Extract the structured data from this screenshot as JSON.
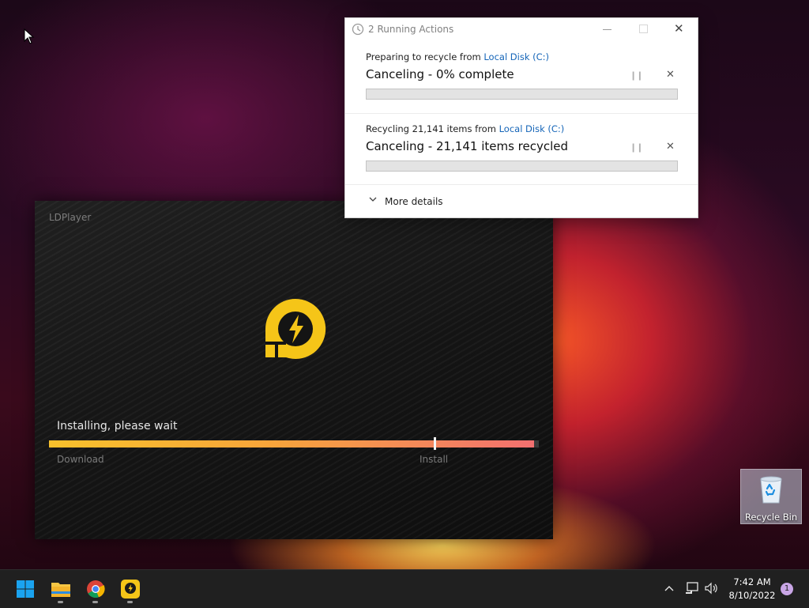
{
  "ldplayer": {
    "title": "LDPlayer",
    "status": "Installing, please wait",
    "progress_fraction": 0.99,
    "steps": [
      "Download",
      "Install"
    ],
    "accent": "#f8c12c"
  },
  "dialog": {
    "title": "2 Running Actions",
    "operations": [
      {
        "prefix": "Preparing to recycle from ",
        "source": "Local Disk (C:)",
        "status": "Canceling - 0% complete",
        "progress_fraction": 0
      },
      {
        "prefix": "Recycling 21,141 items from ",
        "source": "Local Disk (C:)",
        "status": "Canceling - 21,141 items recycled",
        "progress_fraction": 0
      }
    ],
    "more_details": "More details",
    "link_color": "#1565b8"
  },
  "desktop": {
    "recycle_bin_label": "Recycle Bin"
  },
  "taskbar": {
    "apps": [
      {
        "name": "start-button",
        "icon": "windows-logo"
      },
      {
        "name": "file-explorer",
        "icon": "folder-icon"
      },
      {
        "name": "chrome",
        "icon": "chrome-icon"
      },
      {
        "name": "ldplayer",
        "icon": "ldplayer-icon"
      }
    ],
    "time": "7:42 AM",
    "date": "8/10/2022",
    "notification_count": "1"
  }
}
